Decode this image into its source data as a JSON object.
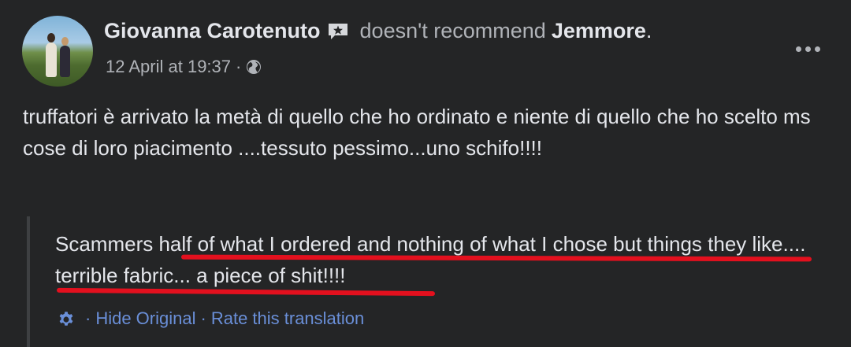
{
  "post": {
    "author": "Giovanna Carotenuto",
    "recommendation_text": "doesn't recommend",
    "page_name": "Jemmore",
    "page_end": ".",
    "timestamp": "12 April at 19:37",
    "meta_separator": "·",
    "privacy_icon": "globe-icon",
    "recommend_icon": "recommendation-star-icon",
    "more_icon": "more-options-icon",
    "original_text": "truffatori è arrivato la metà di quello che ho ordinato e niente di quello che ho scelto ms cose di loro piacimento ....tessuto pessimo...uno schifo!!!!"
  },
  "translation": {
    "text": "Scammers half of what I ordered and nothing of what I chose but things they like.... terrible fabric... a piece of shit!!!!",
    "settings_icon": "gear-icon",
    "separator": "·",
    "hide_original_label": "Hide Original",
    "rate_label": "Rate this translation",
    "highlight_color": "#e3101e"
  },
  "colors": {
    "background": "#242526",
    "text_primary": "#e4e6eb",
    "text_secondary": "#b0b3b8",
    "link": "#6a8fd8"
  }
}
